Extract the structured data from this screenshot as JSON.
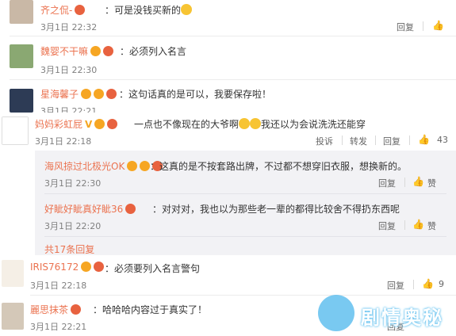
{
  "comments": [
    {
      "name": "齐之侃-",
      "text": "：可是没钱买新的",
      "time": "3月1日 22:32",
      "reply": "回复"
    },
    {
      "name": "魏婴不干嘛",
      "text": "：必须列入名言",
      "time": "3月1日 22:30"
    },
    {
      "name": "星海馨子",
      "text": "：这句话真的是可以，我要保存啦！",
      "time": "3月1日 22:21"
    },
    {
      "name": "妈妈彩虹屁",
      "text": "一点也不像现在的大爷啊",
      "text2": "我还以为会说洗洗还能穿",
      "time": "3月1日 22:18",
      "report": "投诉",
      "forward": "转发",
      "reply": "回复",
      "likes": "43"
    },
    {
      "name": "IRIS76172",
      "text": "：必须要列入名言警句",
      "time": "3月1日 22:18",
      "reply": "回复",
      "likes": "9"
    },
    {
      "name": "麗思抹茶",
      "text": "：哈哈哈内容过于真实了！",
      "time": "3月1日 22:21",
      "reply": "回复"
    }
  ],
  "replies": [
    {
      "name": "海风掠过北极光OK",
      "text": "：这真的是不按套路出牌，不过都不想穿旧衣服，想换新的。",
      "time": "3月1日 22:30",
      "reply": "回复",
      "likes": "赞"
    },
    {
      "name": "好眦好眦真好眦36",
      "text": "：对对对，我也以为那些老一辈的都得比较舍不得扔东西呢",
      "time": "3月1日 22:20",
      "reply": "回复",
      "likes": "赞"
    }
  ],
  "more_replies": "共17条回复",
  "watermark": "剧情奥秘",
  "colors": {
    "name": "#eb7350",
    "accent": "#62c0ef",
    "nested_bg": "#f2f2f5"
  }
}
